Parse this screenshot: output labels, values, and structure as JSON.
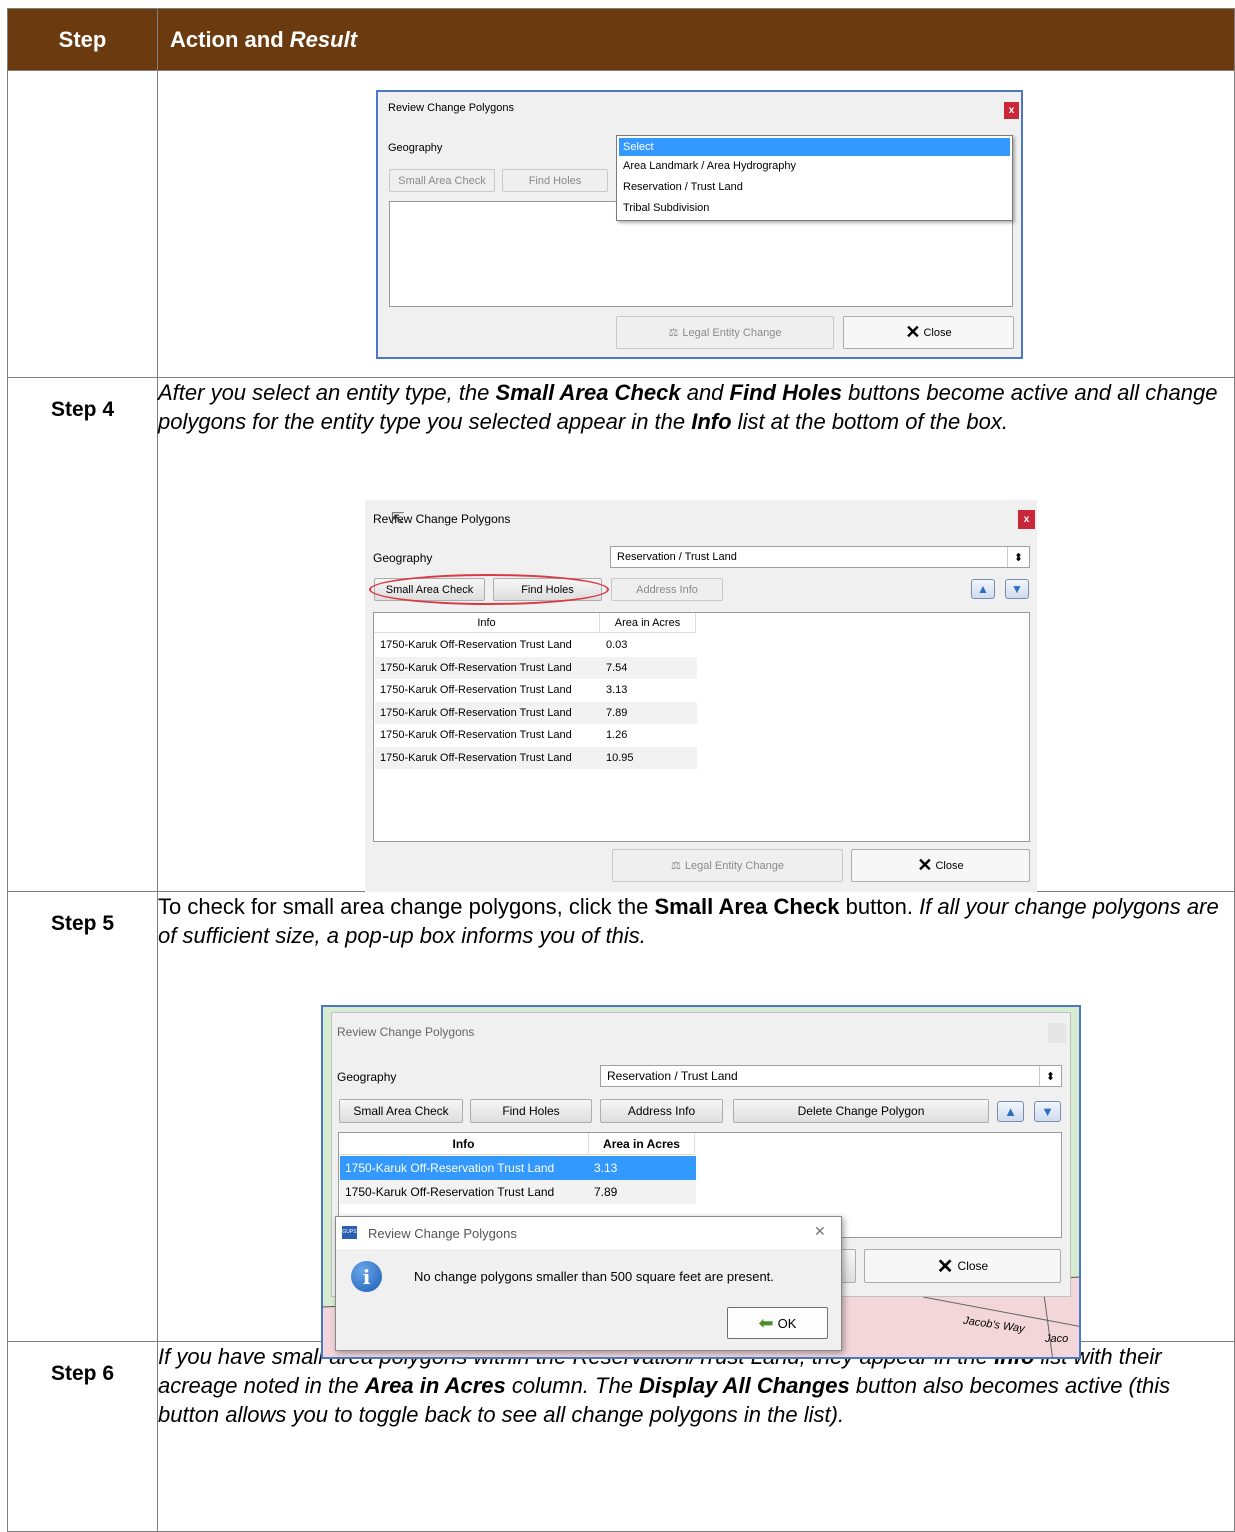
{
  "table": {
    "header_step": "Step",
    "header_action": "Action and",
    "header_result": "Result"
  },
  "dialog1": {
    "title": "Review Change Polygons",
    "close_x": "x",
    "geography_label": "Geography",
    "small_area_check": "Small Area Check",
    "find_holes": "Find Holes",
    "dropdown_options": [
      "Select",
      "Area Landmark / Area Hydrography",
      "Reservation / Trust Land",
      "Tribal Subdivision"
    ],
    "legal_entity_change": "Legal Entity Change",
    "close": "Close"
  },
  "step4": {
    "label": "Step 4",
    "t1": "After you select an entity type, the ",
    "b1": "Small Area Check",
    "t2": " and ",
    "b2": "Find Holes",
    "t3": " buttons become active and all change polygons for the entity type you selected appear in the ",
    "b3": "Info",
    "t4": " list at the bottom of the box."
  },
  "dialog2": {
    "title": "Review Change Polygons",
    "close_x": "x",
    "geography_label": "Geography",
    "geography_value": "Reservation / Trust Land",
    "small_area_check": "Small Area Check",
    "find_holes": "Find Holes",
    "address_info": "Address Info",
    "col_info": "Info",
    "col_area": "Area in Acres",
    "rows": [
      {
        "info": "1750-Karuk Off-Reservation Trust Land",
        "area": "0.03"
      },
      {
        "info": "1750-Karuk Off-Reservation Trust Land",
        "area": "7.54"
      },
      {
        "info": "1750-Karuk Off-Reservation Trust Land",
        "area": "3.13"
      },
      {
        "info": "1750-Karuk Off-Reservation Trust Land",
        "area": "7.89"
      },
      {
        "info": "1750-Karuk Off-Reservation Trust Land",
        "area": "1.26"
      },
      {
        "info": "1750-Karuk Off-Reservation Trust Land",
        "area": "10.95"
      }
    ],
    "legal_entity_change": "Legal Entity Change",
    "close": "Close"
  },
  "step5": {
    "label": "Step 5",
    "t1": "To check for small area change polygons, click the ",
    "b1": "Small Area Check",
    "t2": " button. ",
    "i1": "If all your change polygons are of sufficient size, a pop-up box informs you of this."
  },
  "dialog3": {
    "title": "Review Change Polygons",
    "geography_label": "Geography",
    "geography_value": "Reservation / Trust Land",
    "small_area_check": "Small Area Check",
    "find_holes": "Find Holes",
    "address_info": "Address Info",
    "delete_change_polygon": "Delete Change Polygon",
    "col_info": "Info",
    "col_area": "Area in Acres",
    "rows": [
      {
        "info": "1750-Karuk Off-Reservation Trust Land",
        "area": "3.13"
      },
      {
        "info": "1750-Karuk Off-Reservation Trust Land",
        "area": "7.89"
      }
    ],
    "close": "Close",
    "map_label1": "Jacob's Way",
    "map_label2": "Jaco"
  },
  "popup": {
    "app_icon": "GUPS",
    "title": "Review Change Polygons",
    "close_x": "✕",
    "message": "No change polygons smaller than 500 square feet are present.",
    "ok": "OK"
  },
  "step6": {
    "label": "Step 6",
    "t1": "If you have small area polygons within the Reservation/Trust Land, they appear in the ",
    "b1": "Info",
    "t2": " list with their acreage noted in the ",
    "b2": "Area in Acres",
    "t3": " column. The ",
    "b3": "Display All Changes",
    "t4": " button also becomes active (this button allows you to toggle back to see all change polygons in the list)."
  }
}
